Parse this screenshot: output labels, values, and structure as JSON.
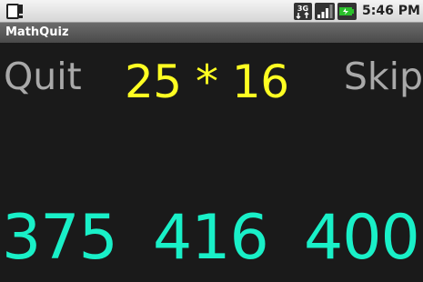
{
  "status_bar": {
    "time": "5:46 PM",
    "network_label": "3G",
    "icons": [
      "notification-icon",
      "network-3g-icon",
      "signal-icon",
      "battery-charging-icon"
    ]
  },
  "app": {
    "title": "MathQuiz"
  },
  "quiz": {
    "quit_label": "Quit",
    "skip_label": "Skip",
    "question": "25 * 16",
    "answers": [
      "375",
      "416",
      "400"
    ]
  },
  "colors": {
    "background": "#1a1a1a",
    "question": "#ffff22",
    "answer": "#19f0c8",
    "button_text": "#a9a9a9"
  }
}
